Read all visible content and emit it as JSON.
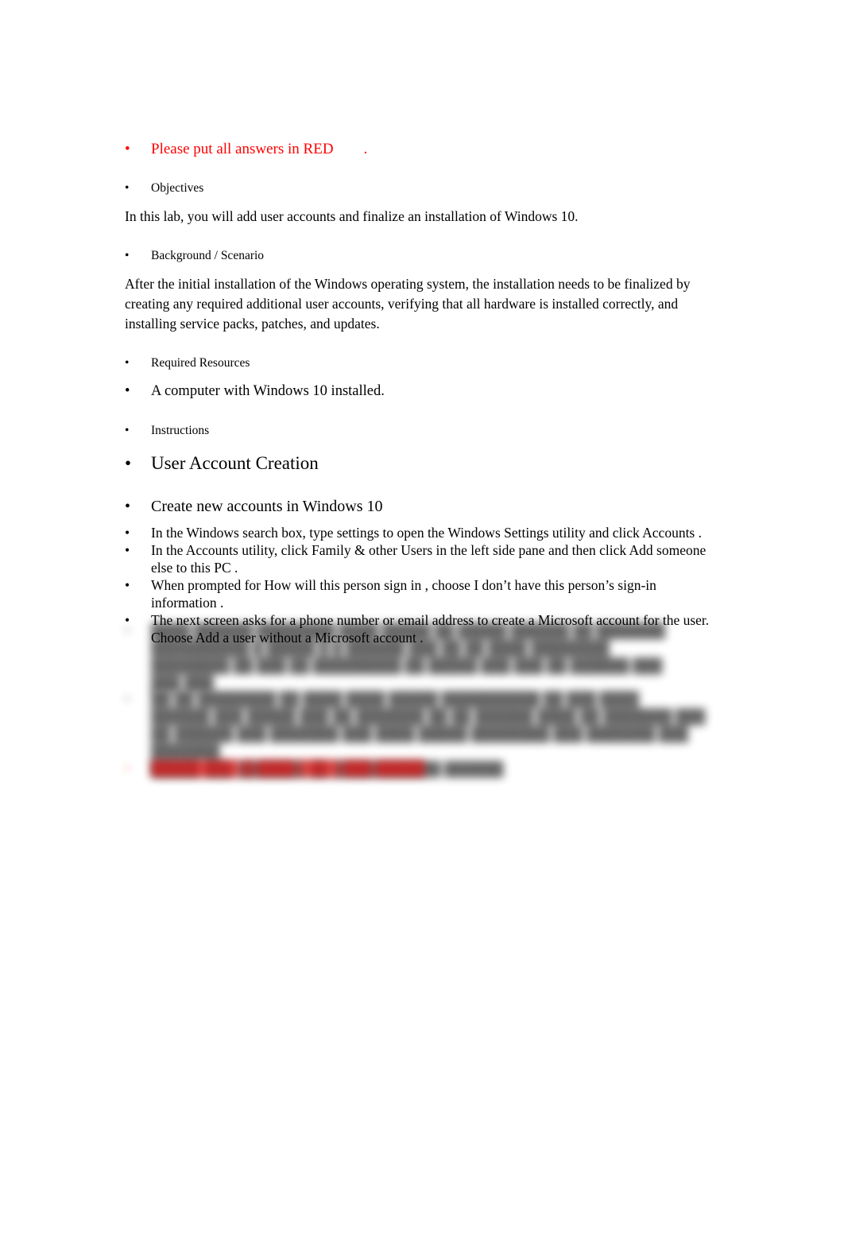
{
  "document": {
    "colors": {
      "text": "#000000",
      "accent_red": "#FF0000",
      "page_background": "#FFFFFF"
    },
    "bullet_glyph": "•",
    "red_notice": {
      "text": "Please put all answers in RED",
      "trailing_period": "."
    },
    "sections": [
      {
        "heading": "Objectives",
        "body": "In this lab, you will add user accounts and finalize an installation of Windows 10."
      },
      {
        "heading": "Background / Scenario",
        "body": "After the initial installation of the Windows operating system, the installation needs to be finalized by creating any required additional user accounts, verifying that all hardware is installed correctly, and installing service packs, patches, and updates."
      }
    ],
    "required_resources": {
      "heading": "Required Resources",
      "items": [
        "A computer with Windows 10 installed."
      ]
    },
    "instructions": {
      "heading": "Instructions",
      "part_title": "User Account Creation",
      "subsection_title": "Create new accounts in Windows 10",
      "steps": [
        "In the Windows search box, type      settings    to open the   Windows Settings       utility and click Accounts   .",
        "In the  Accounts    utility, click Family & other Users       in the left side pane and then click Add someone else to this PC        .",
        "When prompted for    How will this person sign in       , choose   I don’t have this person’s sign-in information     .",
        "The next screen asks for a phone number or email address to create a Microsoft account for the user. Choose       Add a user without a Microsoft account        ."
      ]
    },
    "redacted_steps": [
      {
        "id": "redacted-step-5",
        "state": "blurred",
        "legible": false,
        "color": "#000000",
        "line_widths_pct": [
          100,
          99,
          97,
          22
        ],
        "placeholder_lines": [
          "████ ██████ ████████ ████    █████ ██ █████ ██████ ██  ███████",
          "██████████ █ █████ █ █ ██████ ███ ██ ██ ████ ████████",
          "████████ ██ ███ ██ █████████ ██ █████ ███ ███ ██ ██████ ███",
          "███ ███"
        ]
      },
      {
        "id": "redacted-step-6",
        "state": "blurred",
        "legible": false,
        "color": "#000000",
        "line_widths_pct": [
          92,
          99,
          100,
          50
        ],
        "placeholder_lines": [
          "██ ██ ████████ ██ ████ ████  █████ ██████████ ██ ███ ████",
          "██████ ███ █████ ███ ██ ███████ ██ ██ ██████ ████ ██ ███████ ███",
          "██ ██████ ███ ███████ ███ ████  █████ ████████    ███ ███████ ███ ███████",
          "█████ ███ ███████ ██ ███████████ ██████"
        ]
      },
      {
        "id": "redacted-step-7",
        "state": "blurred",
        "legible": false,
        "color": "#FF0000",
        "line_widths_pct": [
          38
        ],
        "placeholder_lines": [
          "█████████ █ ████ ████ ███ █████"
        ]
      }
    ]
  }
}
